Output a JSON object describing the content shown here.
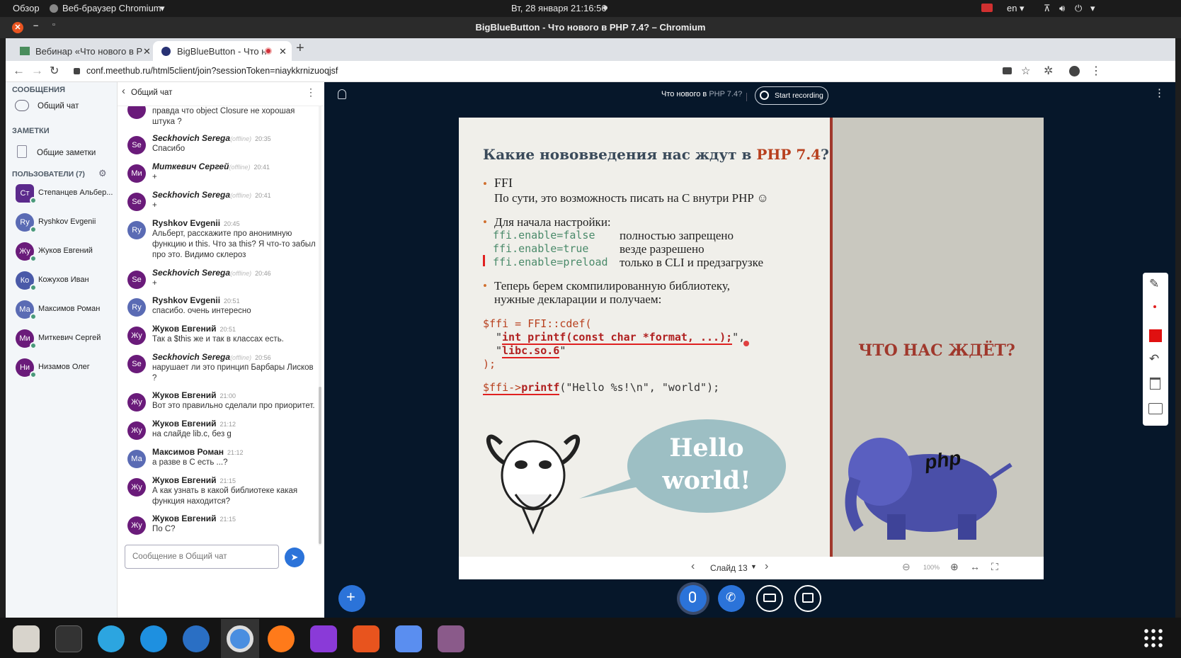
{
  "system": {
    "overview": "Обзор",
    "browser": "Веб-браузер Chromium",
    "clock": "Вт, 28 января  21:16:56",
    "lang": "en"
  },
  "window": {
    "title": "BigBlueButton - Что нового в PHP 7.4? – Chromium"
  },
  "tabs": [
    {
      "label": "Вебинар «Что нового в Р"
    },
    {
      "label": "BigBlueButton - Что н"
    }
  ],
  "address": {
    "url": "conf.meethub.ru/html5client/join?sessionToken=niaykkrnizuoqjsf"
  },
  "sidebar": {
    "messages_heading": "СООБЩЕНИЯ",
    "public_chat": "Общий чат",
    "notes_heading": "ЗАМЕТКИ",
    "shared_notes": "Общие заметки",
    "users_heading": "ПОЛЬЗОВАТЕЛИ (7)",
    "users": [
      {
        "initials": "Ст",
        "name": "Степанцев Альбер...",
        "color": "#5b2a8c"
      },
      {
        "initials": "Ry",
        "name": "Ryshkov Evgenii",
        "color": "#5a6bb4"
      },
      {
        "initials": "Жу",
        "name": "Жуков Евгений",
        "color": "#6a1b7a"
      },
      {
        "initials": "Ко",
        "name": "Кожухов Иван",
        "color": "#4a5aa8"
      },
      {
        "initials": "Ма",
        "name": "Максимов Роман",
        "color": "#5a6bb4"
      },
      {
        "initials": "Ми",
        "name": "Миткевич Сергей",
        "color": "#6a1b7a"
      },
      {
        "initials": "Ни",
        "name": "Низамов Олег",
        "color": "#6a1b7a"
      }
    ]
  },
  "chat": {
    "title": "Общий чат",
    "partial": "правда что object Closure не хорошая штука ?",
    "offline": "(offline)",
    "messages": [
      {
        "initials": "Se",
        "name": "Seckhovich Serega",
        "offline": true,
        "time": "20:35",
        "text": "Спасибо",
        "color": "#6a1b7a"
      },
      {
        "initials": "Ми",
        "name": "Миткевич Сергей",
        "offline": true,
        "time": "20:41",
        "text": "+",
        "color": "#6a1b7a"
      },
      {
        "initials": "Se",
        "name": "Seckhovich Serega",
        "offline": true,
        "time": "20:41",
        "text": "+",
        "color": "#6a1b7a"
      },
      {
        "initials": "Ry",
        "name": "Ryshkov Evgenii",
        "offline": false,
        "time": "20:45",
        "text": "Альберт, расскажите про анонимную функцию и this. Что за this? Я что-то забыл про это. Видимо склероз",
        "color": "#5a6bb4"
      },
      {
        "initials": "Se",
        "name": "Seckhovich Serega",
        "offline": true,
        "time": "20:46",
        "text": "+",
        "color": "#6a1b7a"
      },
      {
        "initials": "Ry",
        "name": "Ryshkov Evgenii",
        "offline": false,
        "time": "20:51",
        "text": "спасибо. очень интересно",
        "color": "#5a6bb4"
      },
      {
        "initials": "Жу",
        "name": "Жуков Евгений",
        "offline": false,
        "time": "20:51",
        "text": "Так а $this же и так в классах есть.",
        "color": "#6a1b7a"
      },
      {
        "initials": "Se",
        "name": "Seckhovich Serega",
        "offline": true,
        "time": "20:56",
        "text": "нарушает ли это принцип Барбары Лисков ?",
        "color": "#6a1b7a"
      },
      {
        "initials": "Жу",
        "name": "Жуков Евгений",
        "offline": false,
        "time": "21:00",
        "text": "Вот это правильно сделали про приоритет.",
        "color": "#6a1b7a"
      },
      {
        "initials": "Жу",
        "name": "Жуков Евгений",
        "offline": false,
        "time": "21:12",
        "text": "на слайде lib.c, без g",
        "color": "#6a1b7a"
      },
      {
        "initials": "Ма",
        "name": "Максимов Роман",
        "offline": false,
        "time": "21:12",
        "text": "а разве в С есть ...?",
        "color": "#5a6bb4"
      },
      {
        "initials": "Жу",
        "name": "Жуков Евгений",
        "offline": false,
        "time": "21:15",
        "text": "А как узнать в какой библиотеке какая функция находится?",
        "color": "#6a1b7a"
      },
      {
        "initials": "Жу",
        "name": "Жуков Евгений",
        "offline": false,
        "time": "21:15",
        "text": "По С?",
        "color": "#6a1b7a"
      }
    ],
    "input_placeholder": "Сообщение в Общий чат"
  },
  "presentation": {
    "title_prefix": "Что нового в",
    "title_suffix": "PHP 7.4?",
    "record_label": "Start recording",
    "slide_label": "Слайд 13",
    "zoom": "100%"
  },
  "slide": {
    "heading_a": "Какие нововведения нас ждут в ",
    "heading_b": "PHP 7.4",
    "heading_c": "?",
    "b1_title": "FFI",
    "b1_text": "По сути, это возможность писать на С внутри PHP ☺",
    "b2_title": "Для начала настройки:",
    "cfg": [
      {
        "code": "ffi.enable=false",
        "desc": "полностью запрещено"
      },
      {
        "code": "ffi.enable=true",
        "desc": "везде разрешено"
      },
      {
        "code": "ffi.enable=preload",
        "desc": "только в CLI и предзагрузке"
      }
    ],
    "b3_line1": "Теперь берем скомпилированную библиотеку,",
    "b3_line2": "нужные декларации и получаем:",
    "code1": "$ffi = FFI::cdef(",
    "code2q1": "\"",
    "code2": "int printf(const char *format, ...);",
    "code2q2": "\",",
    "code3q1": "\"",
    "code3": "libc.so.6",
    "code3q2": "\"",
    "code4": ");",
    "code5a": "$ffi->",
    "code5b": "printf",
    "code5c": "(\"Hello %s!\\n\", \"world\");",
    "bubble1": "Hello",
    "bubble2": "world!",
    "right_title": "ЧТО НАС ЖДЁТ?",
    "php_label": "php"
  }
}
